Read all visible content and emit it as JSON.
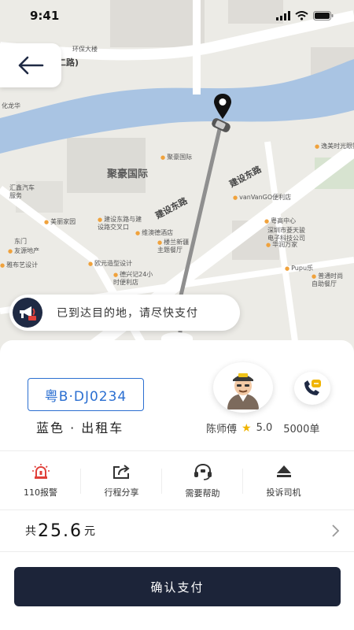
{
  "status_bar": {
    "time": "9:41"
  },
  "map": {
    "labels": {
      "ring_road": "环二路)",
      "env_building": "环保大楼",
      "juhao_plaza": "聚豪国际",
      "juhao_poi": "聚豪国际",
      "jianshe_east_1": "建设东路",
      "jianshe_east_2": "建设东路",
      "vanvango": "vanVanGO便利店",
      "yuehao": "粤高中心",
      "ling_tech": "深圳市菱天骏\n电子科技公司",
      "huarun": "华润万家",
      "pupu": "Pupu乐",
      "yimei": "逸美时光眼镜",
      "jianshe_junction": "建设东路与建\n设路交叉口",
      "weiao_hotel": "维澳德酒店",
      "dilan": "楼兰新疆\n主题餐厅",
      "oulong": "欧元造型设计",
      "dexing": "德兴记24小\n时便利店",
      "putong": "普通时尚\n自助餐厅",
      "huixin": "汇鑫汽车\n服务",
      "meili": "美丽家园",
      "east_gate": "东门",
      "youyuan": "友源地产",
      "yaya": "雅布艺设计",
      "longhua": "化龙华"
    }
  },
  "notice": {
    "text": "已到达目的地，请尽快支付"
  },
  "driver": {
    "plate": "粤B·DJ0234",
    "car_desc": "蓝色 · 出租车",
    "name": "陈师傅",
    "rating": "5.0",
    "orders": "5000单"
  },
  "actions": [
    {
      "label": "110报警",
      "icon": "alarm-icon"
    },
    {
      "label": "行程分享",
      "icon": "share-icon"
    },
    {
      "label": "需要帮助",
      "icon": "help-headset-icon"
    },
    {
      "label": "投诉司机",
      "icon": "complaint-icon"
    }
  ],
  "price": {
    "prefix": "共",
    "amount": "25.6",
    "unit": "元"
  },
  "pay_button": {
    "label": "确认支付"
  },
  "colors": {
    "accent": "#2b6fd1",
    "dark": "#1c2439",
    "river": "#a9c4e3"
  }
}
